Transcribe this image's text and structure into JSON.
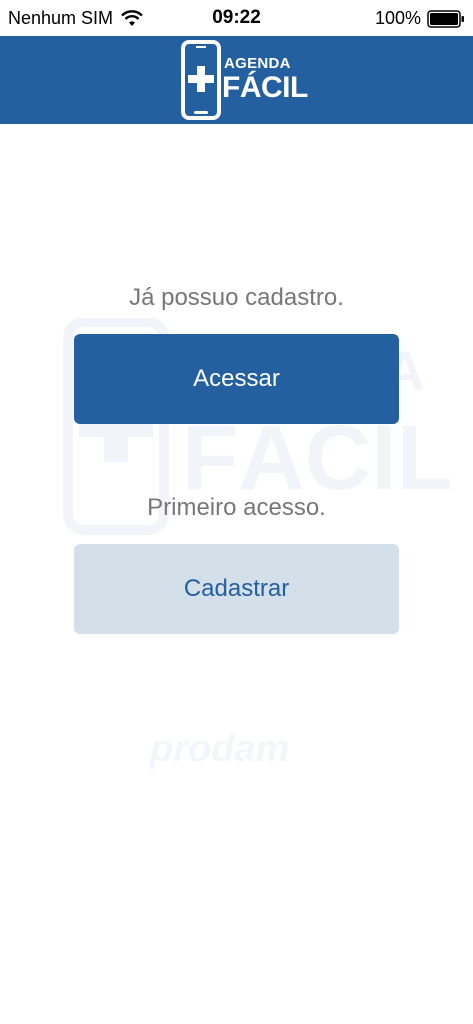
{
  "status_bar": {
    "carrier": "Nenhum SIM",
    "time": "09:22",
    "battery": "100%"
  },
  "header": {
    "logo_line1": "AGENDA",
    "logo_line2": "FÁCIL"
  },
  "login_section": {
    "prompt": "Já possuo cadastro.",
    "button_label": "Acessar"
  },
  "signup_section": {
    "prompt": "Primeiro acesso.",
    "button_label": "Cadastrar"
  },
  "watermark": {
    "brand": "prodam"
  },
  "colors": {
    "brand_blue": "#245f9f",
    "secondary_button_bg": "#d3e0ea",
    "prompt_gray": "#777777"
  }
}
